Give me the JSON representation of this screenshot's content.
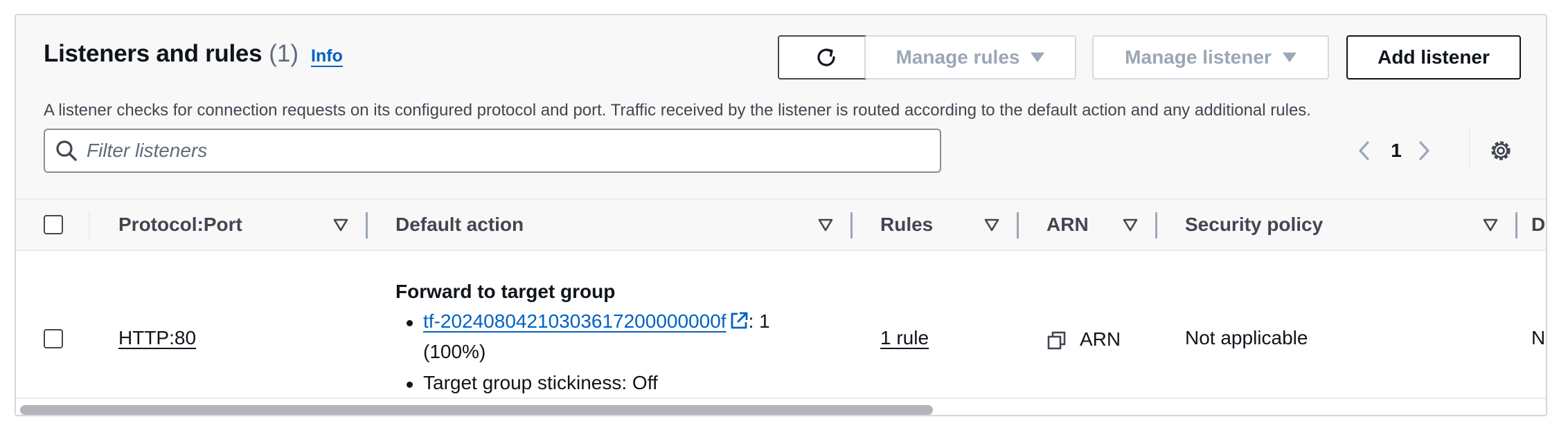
{
  "header": {
    "title": "Listeners and rules",
    "count": "(1)",
    "info_label": "Info",
    "description": "A listener checks for connection requests on its configured protocol and port. Traffic received by the listener is routed according to the default action and any additional rules."
  },
  "toolbar": {
    "refresh_icon": "refresh-icon",
    "manage_rules_label": "Manage rules",
    "manage_listener_label": "Manage listener",
    "add_listener_label": "Add listener"
  },
  "search": {
    "placeholder": "Filter listeners",
    "value": ""
  },
  "pagination": {
    "current_page": "1"
  },
  "table": {
    "columns": [
      {
        "label": "Protocol:Port"
      },
      {
        "label": "Default action"
      },
      {
        "label": "Rules"
      },
      {
        "label": "ARN"
      },
      {
        "label": "Security policy"
      },
      {
        "label": "De"
      }
    ],
    "rows": [
      {
        "protocol_port": "HTTP:80",
        "default_action": {
          "title": "Forward to target group",
          "target_group": "tf-20240804210303617200000000f",
          "weight_suffix": ": 1",
          "weight_percent": "(100%)",
          "stickiness": "Target group stickiness: Off"
        },
        "rules": "1 rule",
        "arn": "ARN",
        "security_policy": "Not applicable",
        "default_ssl_partial": "No"
      }
    ]
  },
  "colors": {
    "link": "#0061c2",
    "text": "#0f141a",
    "muted": "#5f6b7a",
    "disabled": "#9ba7b6",
    "header_bg": "#f8f8f9"
  }
}
